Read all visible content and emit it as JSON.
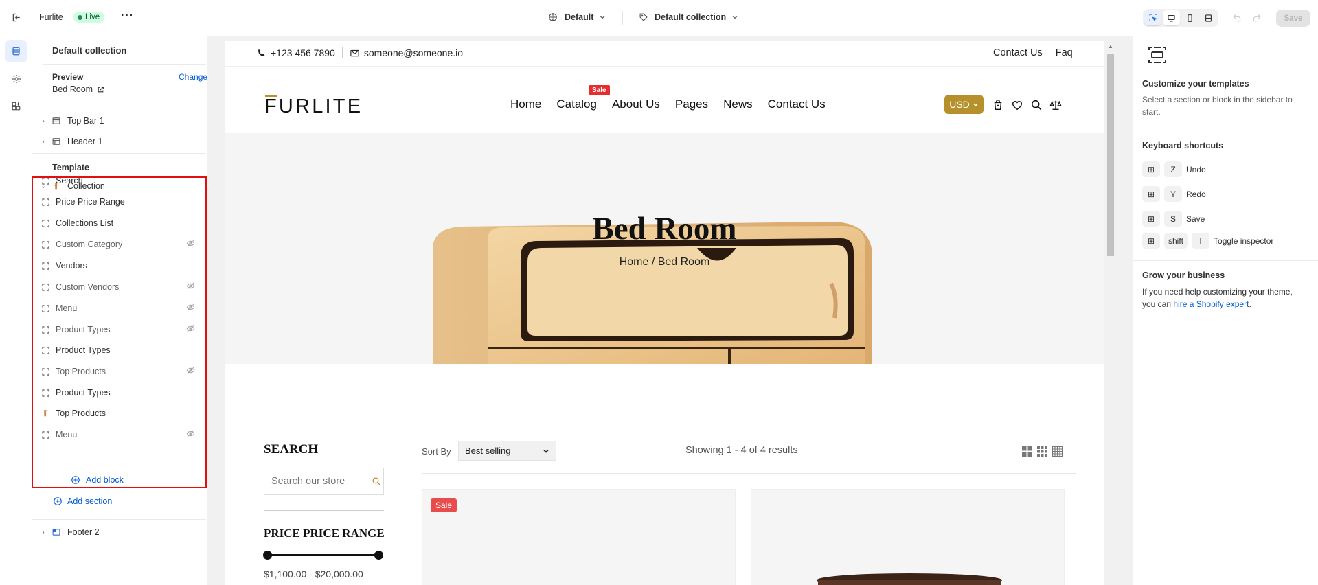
{
  "topbar": {
    "store_name": "Furlite",
    "status_badge": "Live",
    "theme_selector": "Default",
    "template_selector": "Default collection",
    "save_label": "Save"
  },
  "left_panel": {
    "title": "Default collection",
    "preview_label": "Preview",
    "preview_change": "Change",
    "preview_value": "Bed Room",
    "header_sections": [
      "Top Bar 1",
      "Header 1"
    ],
    "template_label": "Template",
    "collection_label": "Collection",
    "blocks": [
      "Search",
      "Price Price Range",
      "Collections List",
      "Custom Category",
      "Vendors",
      "Custom Vendors",
      "Menu",
      "Product Types",
      "Product Types",
      "Top Products",
      "Product Types",
      "Top Products",
      "Menu"
    ],
    "add_block": "Add block",
    "add_section": "Add section",
    "footer_section": "Footer 2"
  },
  "store": {
    "phone": "+123 456 7890",
    "email": "someone@someone.io",
    "contact_link": "Contact Us",
    "faq_link": "Faq",
    "logo": "FURLITE",
    "nav": [
      "Home",
      "Catalog",
      "About Us",
      "Pages",
      "News",
      "Contact Us"
    ],
    "sale_tag": "Sale",
    "currency": "USD",
    "hero_title": "Bed Room",
    "breadcrumb": "Home / Bed Room",
    "search_heading": "SEARCH",
    "search_placeholder": "Search our store",
    "price_heading": "PRICE PRICE RANGE",
    "price_range": "$1,100.00 - $20,000.00",
    "sort_label": "Sort By",
    "sort_value": "Best selling",
    "showing": "Showing 1 - 4 of 4 results",
    "product_badge": "Sale"
  },
  "right_panel": {
    "customize_title": "Customize your templates",
    "customize_desc": "Select a section or block in the sidebar to start.",
    "shortcuts_title": "Keyboard shortcuts",
    "shortcuts": [
      {
        "key": "Z",
        "label": "Undo"
      },
      {
        "key": "Y",
        "label": "Redo"
      },
      {
        "key": "S",
        "label": "Save"
      },
      {
        "key": "shift",
        "key2": "I",
        "label": "Toggle inspector"
      }
    ],
    "grow_title": "Grow your business",
    "grow_text": "If you need help customizing your theme, you can",
    "grow_link": "hire a Shopify expert",
    "grow_end": "."
  }
}
